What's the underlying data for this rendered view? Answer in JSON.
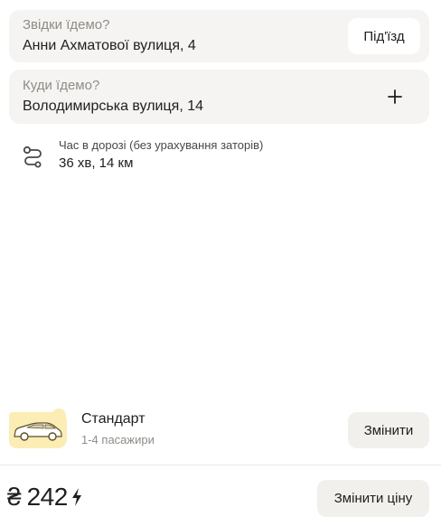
{
  "from": {
    "label": "Звідки їдемо?",
    "address": "Анни Ахматової вулиця, 4",
    "entrance_button": "Під'їзд"
  },
  "to": {
    "label": "Куди їдемо?",
    "address": "Володимирська вулиця, 14",
    "add_icon": "plus-icon"
  },
  "route": {
    "icon": "route-icon",
    "caption": "Час в дорозі (без урахування заторів)",
    "value": "36 хв, 14 км"
  },
  "tariff": {
    "icon": "car-icon",
    "name": "Стандарт",
    "capacity": "1-4 пасажири",
    "change_button": "Змінити",
    "badge_color": "#fcedb5"
  },
  "price": {
    "currency": "₴",
    "value": "242",
    "surge_icon": "lightning-icon",
    "change_button": "Змінити ціну"
  }
}
